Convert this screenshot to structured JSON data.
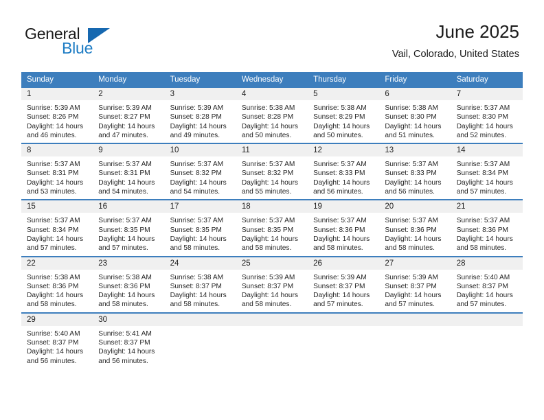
{
  "brand": {
    "name_part1": "General",
    "name_part2": "Blue",
    "color_dark": "#1a1a1a",
    "color_blue": "#1d7cc4",
    "triangle_color": "#1668b0"
  },
  "header": {
    "title": "June 2025",
    "subtitle": "Vail, Colorado, United States"
  },
  "theme": {
    "header_row_bg": "#3d7ebd",
    "header_row_text": "#ffffff",
    "day_number_bg": "#f0f0f0",
    "cell_bg": "#ffffff",
    "row_divider": "#3d7ebd"
  },
  "weekday_headers": [
    "Sunday",
    "Monday",
    "Tuesday",
    "Wednesday",
    "Thursday",
    "Friday",
    "Saturday"
  ],
  "weeks": [
    [
      {
        "day": "1",
        "sunrise": "Sunrise: 5:39 AM",
        "sunset": "Sunset: 8:26 PM",
        "daylight_line1": "Daylight: 14 hours",
        "daylight_line2": "and 46 minutes."
      },
      {
        "day": "2",
        "sunrise": "Sunrise: 5:39 AM",
        "sunset": "Sunset: 8:27 PM",
        "daylight_line1": "Daylight: 14 hours",
        "daylight_line2": "and 47 minutes."
      },
      {
        "day": "3",
        "sunrise": "Sunrise: 5:39 AM",
        "sunset": "Sunset: 8:28 PM",
        "daylight_line1": "Daylight: 14 hours",
        "daylight_line2": "and 49 minutes."
      },
      {
        "day": "4",
        "sunrise": "Sunrise: 5:38 AM",
        "sunset": "Sunset: 8:28 PM",
        "daylight_line1": "Daylight: 14 hours",
        "daylight_line2": "and 50 minutes."
      },
      {
        "day": "5",
        "sunrise": "Sunrise: 5:38 AM",
        "sunset": "Sunset: 8:29 PM",
        "daylight_line1": "Daylight: 14 hours",
        "daylight_line2": "and 50 minutes."
      },
      {
        "day": "6",
        "sunrise": "Sunrise: 5:38 AM",
        "sunset": "Sunset: 8:30 PM",
        "daylight_line1": "Daylight: 14 hours",
        "daylight_line2": "and 51 minutes."
      },
      {
        "day": "7",
        "sunrise": "Sunrise: 5:37 AM",
        "sunset": "Sunset: 8:30 PM",
        "daylight_line1": "Daylight: 14 hours",
        "daylight_line2": "and 52 minutes."
      }
    ],
    [
      {
        "day": "8",
        "sunrise": "Sunrise: 5:37 AM",
        "sunset": "Sunset: 8:31 PM",
        "daylight_line1": "Daylight: 14 hours",
        "daylight_line2": "and 53 minutes."
      },
      {
        "day": "9",
        "sunrise": "Sunrise: 5:37 AM",
        "sunset": "Sunset: 8:31 PM",
        "daylight_line1": "Daylight: 14 hours",
        "daylight_line2": "and 54 minutes."
      },
      {
        "day": "10",
        "sunrise": "Sunrise: 5:37 AM",
        "sunset": "Sunset: 8:32 PM",
        "daylight_line1": "Daylight: 14 hours",
        "daylight_line2": "and 54 minutes."
      },
      {
        "day": "11",
        "sunrise": "Sunrise: 5:37 AM",
        "sunset": "Sunset: 8:32 PM",
        "daylight_line1": "Daylight: 14 hours",
        "daylight_line2": "and 55 minutes."
      },
      {
        "day": "12",
        "sunrise": "Sunrise: 5:37 AM",
        "sunset": "Sunset: 8:33 PM",
        "daylight_line1": "Daylight: 14 hours",
        "daylight_line2": "and 56 minutes."
      },
      {
        "day": "13",
        "sunrise": "Sunrise: 5:37 AM",
        "sunset": "Sunset: 8:33 PM",
        "daylight_line1": "Daylight: 14 hours",
        "daylight_line2": "and 56 minutes."
      },
      {
        "day": "14",
        "sunrise": "Sunrise: 5:37 AM",
        "sunset": "Sunset: 8:34 PM",
        "daylight_line1": "Daylight: 14 hours",
        "daylight_line2": "and 57 minutes."
      }
    ],
    [
      {
        "day": "15",
        "sunrise": "Sunrise: 5:37 AM",
        "sunset": "Sunset: 8:34 PM",
        "daylight_line1": "Daylight: 14 hours",
        "daylight_line2": "and 57 minutes."
      },
      {
        "day": "16",
        "sunrise": "Sunrise: 5:37 AM",
        "sunset": "Sunset: 8:35 PM",
        "daylight_line1": "Daylight: 14 hours",
        "daylight_line2": "and 57 minutes."
      },
      {
        "day": "17",
        "sunrise": "Sunrise: 5:37 AM",
        "sunset": "Sunset: 8:35 PM",
        "daylight_line1": "Daylight: 14 hours",
        "daylight_line2": "and 58 minutes."
      },
      {
        "day": "18",
        "sunrise": "Sunrise: 5:37 AM",
        "sunset": "Sunset: 8:35 PM",
        "daylight_line1": "Daylight: 14 hours",
        "daylight_line2": "and 58 minutes."
      },
      {
        "day": "19",
        "sunrise": "Sunrise: 5:37 AM",
        "sunset": "Sunset: 8:36 PM",
        "daylight_line1": "Daylight: 14 hours",
        "daylight_line2": "and 58 minutes."
      },
      {
        "day": "20",
        "sunrise": "Sunrise: 5:37 AM",
        "sunset": "Sunset: 8:36 PM",
        "daylight_line1": "Daylight: 14 hours",
        "daylight_line2": "and 58 minutes."
      },
      {
        "day": "21",
        "sunrise": "Sunrise: 5:37 AM",
        "sunset": "Sunset: 8:36 PM",
        "daylight_line1": "Daylight: 14 hours",
        "daylight_line2": "and 58 minutes."
      }
    ],
    [
      {
        "day": "22",
        "sunrise": "Sunrise: 5:38 AM",
        "sunset": "Sunset: 8:36 PM",
        "daylight_line1": "Daylight: 14 hours",
        "daylight_line2": "and 58 minutes."
      },
      {
        "day": "23",
        "sunrise": "Sunrise: 5:38 AM",
        "sunset": "Sunset: 8:36 PM",
        "daylight_line1": "Daylight: 14 hours",
        "daylight_line2": "and 58 minutes."
      },
      {
        "day": "24",
        "sunrise": "Sunrise: 5:38 AM",
        "sunset": "Sunset: 8:37 PM",
        "daylight_line1": "Daylight: 14 hours",
        "daylight_line2": "and 58 minutes."
      },
      {
        "day": "25",
        "sunrise": "Sunrise: 5:39 AM",
        "sunset": "Sunset: 8:37 PM",
        "daylight_line1": "Daylight: 14 hours",
        "daylight_line2": "and 58 minutes."
      },
      {
        "day": "26",
        "sunrise": "Sunrise: 5:39 AM",
        "sunset": "Sunset: 8:37 PM",
        "daylight_line1": "Daylight: 14 hours",
        "daylight_line2": "and 57 minutes."
      },
      {
        "day": "27",
        "sunrise": "Sunrise: 5:39 AM",
        "sunset": "Sunset: 8:37 PM",
        "daylight_line1": "Daylight: 14 hours",
        "daylight_line2": "and 57 minutes."
      },
      {
        "day": "28",
        "sunrise": "Sunrise: 5:40 AM",
        "sunset": "Sunset: 8:37 PM",
        "daylight_line1": "Daylight: 14 hours",
        "daylight_line2": "and 57 minutes."
      }
    ],
    [
      {
        "day": "29",
        "sunrise": "Sunrise: 5:40 AM",
        "sunset": "Sunset: 8:37 PM",
        "daylight_line1": "Daylight: 14 hours",
        "daylight_line2": "and 56 minutes."
      },
      {
        "day": "30",
        "sunrise": "Sunrise: 5:41 AM",
        "sunset": "Sunset: 8:37 PM",
        "daylight_line1": "Daylight: 14 hours",
        "daylight_line2": "and 56 minutes."
      },
      {
        "day": "",
        "sunrise": "",
        "sunset": "",
        "daylight_line1": "",
        "daylight_line2": ""
      },
      {
        "day": "",
        "sunrise": "",
        "sunset": "",
        "daylight_line1": "",
        "daylight_line2": ""
      },
      {
        "day": "",
        "sunrise": "",
        "sunset": "",
        "daylight_line1": "",
        "daylight_line2": ""
      },
      {
        "day": "",
        "sunrise": "",
        "sunset": "",
        "daylight_line1": "",
        "daylight_line2": ""
      },
      {
        "day": "",
        "sunrise": "",
        "sunset": "",
        "daylight_line1": "",
        "daylight_line2": ""
      }
    ]
  ]
}
